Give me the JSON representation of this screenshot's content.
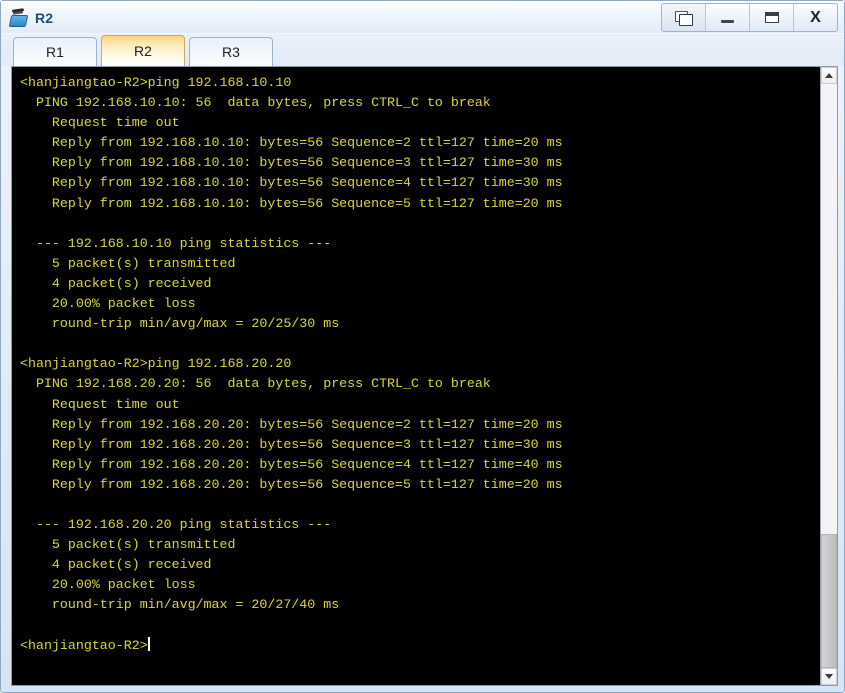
{
  "window": {
    "title": "R2",
    "icon": "router-icon",
    "controls": [
      {
        "name": "restore-button",
        "label": "",
        "glyph": "restore-icon"
      },
      {
        "name": "minimize-button",
        "label": "",
        "glyph": "minimize-icon"
      },
      {
        "name": "maximize-button",
        "label": "",
        "glyph": "maximize-icon"
      },
      {
        "name": "close-button",
        "label": "X",
        "glyph": "close-icon"
      }
    ]
  },
  "tabs": [
    {
      "label": "R1",
      "active": false
    },
    {
      "label": "R2",
      "active": true
    },
    {
      "label": "R3",
      "active": false
    }
  ],
  "terminal": {
    "foreground_color": "#d8d83a",
    "background_color": "#000000",
    "prompt": "<hanjiangtao-R2>",
    "lines": [
      "<hanjiangtao-R2>ping 192.168.10.10",
      "  PING 192.168.10.10: 56  data bytes, press CTRL_C to break",
      "    Request time out",
      "    Reply from 192.168.10.10: bytes=56 Sequence=2 ttl=127 time=20 ms",
      "    Reply from 192.168.10.10: bytes=56 Sequence=3 ttl=127 time=30 ms",
      "    Reply from 192.168.10.10: bytes=56 Sequence=4 ttl=127 time=30 ms",
      "    Reply from 192.168.10.10: bytes=56 Sequence=5 ttl=127 time=20 ms",
      "",
      "  --- 192.168.10.10 ping statistics ---",
      "    5 packet(s) transmitted",
      "    4 packet(s) received",
      "    20.00% packet loss",
      "    round-trip min/avg/max = 20/25/30 ms",
      "",
      "<hanjiangtao-R2>ping 192.168.20.20",
      "  PING 192.168.20.20: 56  data bytes, press CTRL_C to break",
      "    Request time out",
      "    Reply from 192.168.20.20: bytes=56 Sequence=2 ttl=127 time=20 ms",
      "    Reply from 192.168.20.20: bytes=56 Sequence=3 ttl=127 time=30 ms",
      "    Reply from 192.168.20.20: bytes=56 Sequence=4 ttl=127 time=40 ms",
      "    Reply from 192.168.20.20: bytes=56 Sequence=5 ttl=127 time=20 ms",
      "",
      "  --- 192.168.20.20 ping statistics ---",
      "    5 packet(s) transmitted",
      "    4 packet(s) received",
      "    20.00% packet loss",
      "    round-trip min/avg/max = 20/27/40 ms",
      "",
      "<hanjiangtao-R2>"
    ]
  },
  "scrollbar": {
    "up_arrow": "scroll-up-icon",
    "down_arrow": "scroll-down-icon",
    "thumb_top_percent": 77,
    "thumb_height_percent": 23
  }
}
